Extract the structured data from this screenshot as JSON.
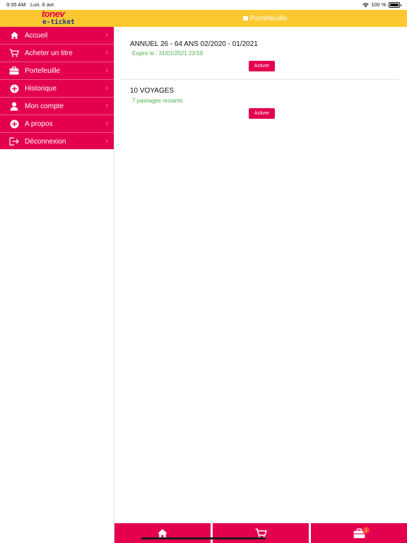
{
  "status": {
    "time": "9:35 AM",
    "date": "Lun. 6 avr.",
    "battery": "100 %"
  },
  "header": {
    "logo_brand": "tonev",
    "logo_sub": "e-ticket",
    "title": "Portefeuille",
    "background": "#fdc82f",
    "title_icon": "wallet-icon"
  },
  "sidebar": {
    "background": "#e4004f",
    "items": [
      {
        "label": "Accueil",
        "icon": "home-icon"
      },
      {
        "label": "Acheter un titre",
        "icon": "cart-icon"
      },
      {
        "label": "Portefeuille",
        "icon": "briefcase-icon"
      },
      {
        "label": "Historique",
        "icon": "plus-circle-icon"
      },
      {
        "label": "Mon compte",
        "icon": "user-icon"
      },
      {
        "label": "A propos",
        "icon": "plus-circle-icon"
      },
      {
        "label": "Déconnexion",
        "icon": "logout-icon"
      }
    ]
  },
  "tickets": [
    {
      "title": "ANNUEL 26 - 64 ANS 02/2020 - 01/2021",
      "subtitle": "Expire le : 31/01/2021 23:59",
      "button": "Activer"
    },
    {
      "title": "10 VOYAGES",
      "subtitle": "7 passages restants",
      "button": "Activer"
    }
  ],
  "tabbar": {
    "tabs": [
      {
        "name": "home",
        "icon": "home-icon"
      },
      {
        "name": "cart",
        "icon": "cart-icon"
      },
      {
        "name": "wallet",
        "icon": "briefcase-icon",
        "badge": "2"
      }
    ]
  }
}
